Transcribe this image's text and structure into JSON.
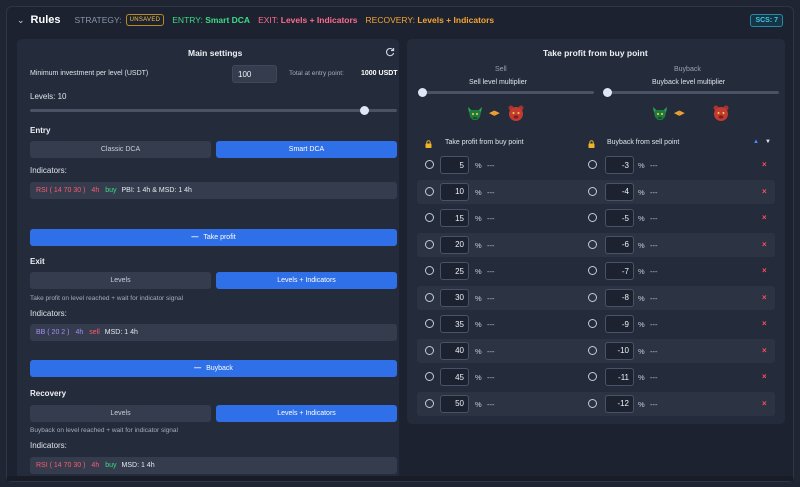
{
  "header": {
    "title": "Rules",
    "strategy_label": "STRATEGY:",
    "strategy_badge": "UNSAVED",
    "entry_label": "ENTRY:",
    "entry_value": "Smart DCA",
    "exit_label": "EXIT:",
    "exit_value": "Levels + Indicators",
    "recovery_label": "RECOVERY:",
    "recovery_value": "Levels + Indicators",
    "scs_badge": "SCS: 7"
  },
  "main": {
    "title": "Main settings",
    "min_invest_label": "Minimum investment per level (USDT)",
    "min_invest_value": "100",
    "total_label": "Total at entry point:",
    "total_value": "1000 USDT",
    "levels_label": "Levels: 10",
    "levels_value": 10,
    "levels_max": 11
  },
  "entry": {
    "title": "Entry",
    "options": [
      "Classic DCA",
      "Smart DCA"
    ],
    "selected": "Smart DCA",
    "indicators_label": "Indicators:",
    "indicator": {
      "name": "RSI ( 14 70 30 )",
      "tf": "4h",
      "side": "buy",
      "extra": "PBI: 1 4h & MSD: 1 4h"
    }
  },
  "take_profit_button": "Take profit",
  "exit": {
    "title": "Exit",
    "options": [
      "Levels",
      "Levels + Indicators"
    ],
    "selected": "Levels + Indicators",
    "hint": "Take profit on level reached + wait for indicator signal",
    "indicators_label": "Indicators:",
    "indicator": {
      "name": "BB ( 20 2 )",
      "tf": "4h",
      "side": "sell",
      "extra": "MSD: 1 4h"
    }
  },
  "buyback_button": "Buyback",
  "recovery": {
    "title": "Recovery",
    "options": [
      "Levels",
      "Levels + Indicators"
    ],
    "selected": "Levels + Indicators",
    "hint": "Buyback on level reached + wait for indicator signal",
    "indicators_label": "Indicators:",
    "indicator": {
      "name": "RSI ( 14 70 30 )",
      "tf": "4h",
      "side": "buy",
      "extra": "MSD: 1 4h"
    }
  },
  "tp_panel": {
    "title": "Take profit from buy point",
    "sell_label": "Sell",
    "sell_multiplier_label": "Sell level multiplier",
    "buyback_label": "Buyback",
    "buyback_multiplier_label": "Buyback level multiplier",
    "col_tp": "Take profit from buy point",
    "col_bb": "Buyback from sell point",
    "rows": [
      {
        "tp": "5",
        "bb": "-3"
      },
      {
        "tp": "10",
        "bb": "-4"
      },
      {
        "tp": "15",
        "bb": "-5"
      },
      {
        "tp": "20",
        "bb": "-6"
      },
      {
        "tp": "25",
        "bb": "-7"
      },
      {
        "tp": "30",
        "bb": "-8"
      },
      {
        "tp": "35",
        "bb": "-9"
      },
      {
        "tp": "40",
        "bb": "-10"
      },
      {
        "tp": "45",
        "bb": "-11"
      },
      {
        "tp": "50",
        "bb": "-12"
      }
    ],
    "percent_symbol": "%",
    "empty_value": "---",
    "delete_symbol": "×"
  },
  "colors": {
    "accent": "#2f6fe8",
    "green": "#3ddc84",
    "pink": "#ff6b8b",
    "orange": "#f7a531",
    "red": "#ff5a6e",
    "purple": "#a78bfa"
  },
  "icons": [
    "chevron-down-icon",
    "refresh-icon",
    "lock-icon",
    "bull-icon",
    "bear-icon",
    "swap-arrows-icon",
    "sort-up-icon",
    "sort-down-icon",
    "delete-icon"
  ]
}
